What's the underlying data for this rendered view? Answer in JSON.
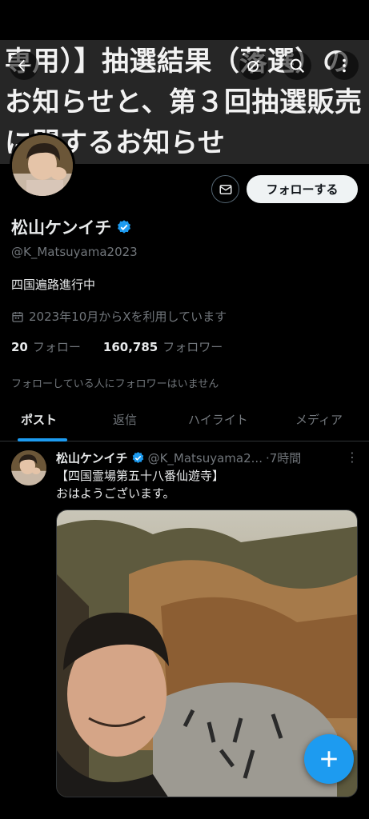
{
  "banner": {
    "text": "専用）】抽選結果（落選）のお知らせと、第３回抽選販売に関するお知らせ"
  },
  "icons": {
    "back": "arrow-left-icon",
    "grok": "grok-icon",
    "search": "search-icon",
    "more": "more-vertical-icon",
    "message": "envelope-icon",
    "verified": "verified-badge-icon",
    "calendar": "calendar-icon",
    "compose": "plus-icon"
  },
  "profile": {
    "follow_label": "フォローする",
    "name": "松山ケンイチ",
    "handle": "@K_Matsuyama2023",
    "bio": "四国遍路進行中",
    "joined": "2023年10月からXを利用しています",
    "following_count": "20",
    "following_label": "フォロー",
    "followers_count": "160,785",
    "followers_label": "フォロワー",
    "mutual_note": "フォローしている人にフォロワーはいません"
  },
  "tabs": [
    {
      "label": "ポスト",
      "active": true
    },
    {
      "label": "返信",
      "active": false
    },
    {
      "label": "ハイライト",
      "active": false
    },
    {
      "label": "メディア",
      "active": false
    }
  ],
  "post": {
    "name": "松山ケンイチ",
    "handle": "@K_Matsuyama2...",
    "time": "·7時間",
    "more": "⋮",
    "line1": "【四国霊場第五十八番仙遊寺】",
    "line2": "おはようございます。"
  },
  "colors": {
    "accent": "#1d9bf0",
    "background": "#000000",
    "text": "#e7e9ea",
    "muted": "#71767b"
  }
}
